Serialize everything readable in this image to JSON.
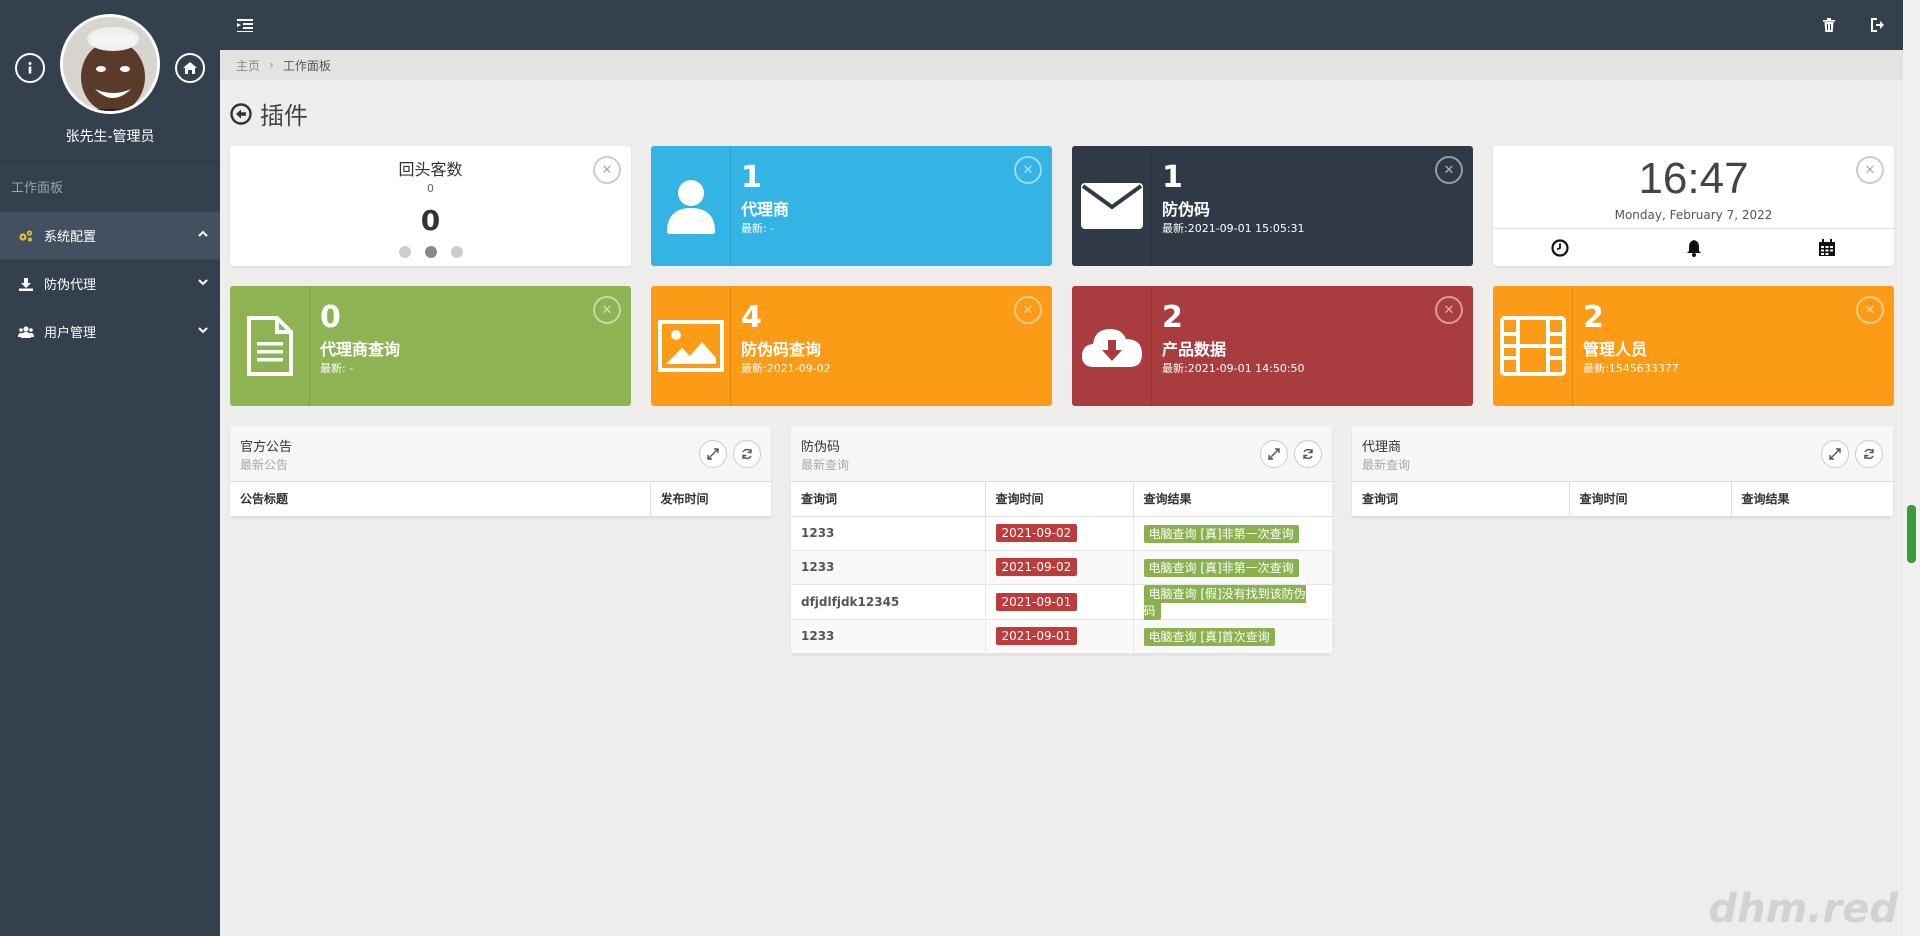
{
  "sidebar": {
    "user_name": "张先生-管理员",
    "nav_header": "工作面板",
    "items": [
      {
        "label": "系统配置",
        "icon": "gears-icon"
      },
      {
        "label": "防伪代理",
        "icon": "download-icon"
      },
      {
        "label": "用户管理",
        "icon": "users-icon"
      }
    ]
  },
  "breadcrumb": {
    "home": "主页",
    "current": "工作面板"
  },
  "page_title": "插件",
  "counter_tile": {
    "title": "回头客数",
    "subtitle": "0",
    "value": "0",
    "active_dot": 2
  },
  "tiles": [
    {
      "number": "1",
      "label": "代理商",
      "sub": "最新: -",
      "icon": "user-icon",
      "color": "#34b4e4"
    },
    {
      "number": "1",
      "label": "防伪码",
      "sub": "最新:2021-09-01 15:05:31",
      "icon": "envelope-icon",
      "color": "#2f3a46"
    },
    {
      "number": "0",
      "label": "代理商查询",
      "sub": "最新: -",
      "icon": "document-icon",
      "color": "#8db352"
    },
    {
      "number": "4",
      "label": "防伪码查询",
      "sub": "最新:2021-09-02",
      "icon": "image-icon",
      "color": "#fb9b16"
    },
    {
      "number": "2",
      "label": "产品数据",
      "sub": "最新:2021-09-01 14:50:50",
      "icon": "cloud-download-icon",
      "color": "#a83c3f"
    },
    {
      "number": "2",
      "label": "管理人员",
      "sub": "最新:1545633377",
      "icon": "film-icon",
      "color": "#fb9b16"
    }
  ],
  "clock": {
    "time": "16:47",
    "date": "Monday, February 7, 2022"
  },
  "panels": {
    "notice": {
      "title": "官方公告",
      "subtitle": "最新公告",
      "columns": [
        "公告标题",
        "发布时间"
      ]
    },
    "code": {
      "title": "防伪码",
      "subtitle": "最新查询",
      "columns": [
        "查询词",
        "查询时间",
        "查询结果"
      ],
      "rows": [
        {
          "word": "1233",
          "time": "2021-09-02",
          "result": "电脑查询 [真]非第一次查询"
        },
        {
          "word": "1233",
          "time": "2021-09-02",
          "result": "电脑查询 [真]非第一次查询"
        },
        {
          "word": "dfjdlfjdk12345",
          "time": "2021-09-01",
          "result": "电脑查询 [假]没有找到该防伪码"
        },
        {
          "word": "1233",
          "time": "2021-09-01",
          "result": "电脑查询 [真]首次查询"
        }
      ]
    },
    "agent": {
      "title": "代理商",
      "subtitle": "最新查询",
      "columns": [
        "查询词",
        "查询时间",
        "查询结果"
      ]
    }
  },
  "watermark": "dhm.red"
}
